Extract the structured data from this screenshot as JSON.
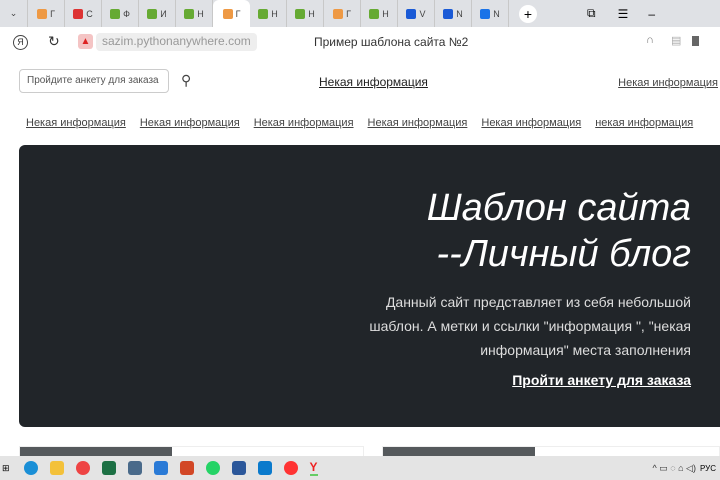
{
  "tabs": [
    {
      "label": "Г",
      "color": "#e94"
    },
    {
      "label": "С",
      "color": "#d33"
    },
    {
      "label": "Ф",
      "color": "#6a3"
    },
    {
      "label": "И",
      "color": "#6a3"
    },
    {
      "label": "Н",
      "color": "#6a3"
    },
    {
      "label": "Г",
      "color": "#e94",
      "active": true
    },
    {
      "label": "Н",
      "color": "#6a3"
    },
    {
      "label": "Н",
      "color": "#6a3"
    },
    {
      "label": "Г",
      "color": "#e94"
    },
    {
      "label": "Н",
      "color": "#6a3"
    },
    {
      "label": "V",
      "color": "#1a5ad6"
    },
    {
      "label": "Ν",
      "color": "#1a5ad6"
    },
    {
      "label": "Ν",
      "color": "#1a73e8"
    }
  ],
  "browser": {
    "url": "sazim.pythonanywhere.com",
    "title": "Пример шаблона сайта №2",
    "new_tab": "+"
  },
  "header": {
    "search_placeholder": "Пройдите анкету для заказа",
    "center_link": "Некая информация",
    "right_link": "Некая информация"
  },
  "nav": [
    "Некая информация",
    "Некая информация",
    "Некая информация",
    "Некая информация",
    "Некая информация",
    "некая информация"
  ],
  "hero": {
    "title_line1": "Шаблон сайта",
    "title_line2": "--Личный блог",
    "lead": "Данный сайт представляет из себя небольшой шаблон. А метки и ссылки \"информация \", \"некая информация\" места заполнения",
    "cta": "Пройти анкету для заказа"
  },
  "taskbar": {
    "lang": "РУС"
  }
}
